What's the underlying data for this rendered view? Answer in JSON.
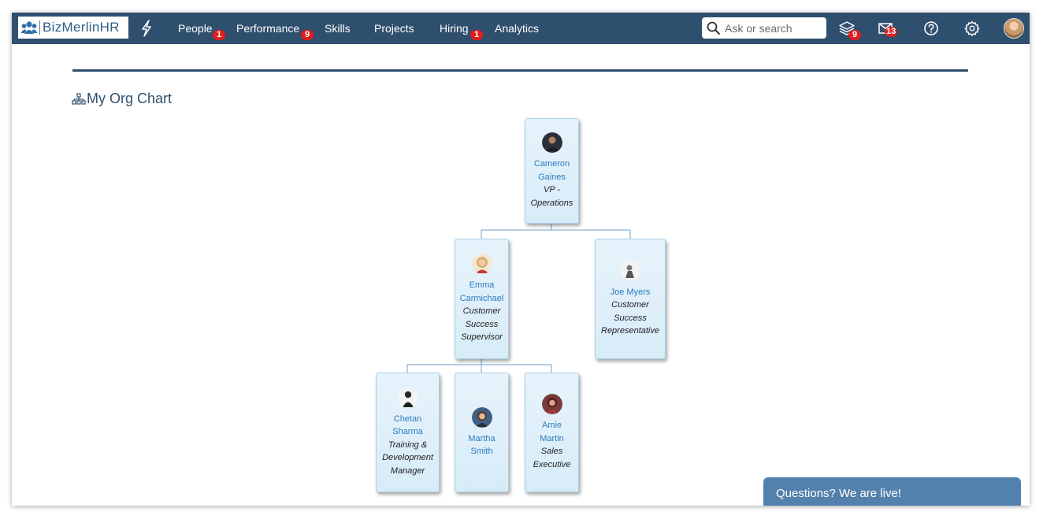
{
  "app": {
    "brand": "BizMerlinHR"
  },
  "nav": {
    "items": [
      {
        "label": "People",
        "badge": "1"
      },
      {
        "label": "Performance",
        "badge": "9"
      },
      {
        "label": "Skills",
        "badge": ""
      },
      {
        "label": "Projects",
        "badge": ""
      },
      {
        "label": "Hiring",
        "badge": "1"
      },
      {
        "label": "Analytics",
        "badge": ""
      }
    ],
    "search_placeholder": "Ask or search",
    "icons": [
      {
        "name": "layers-icon",
        "badge": "9"
      },
      {
        "name": "mail-icon",
        "badge": "13"
      },
      {
        "name": "help-icon",
        "badge": ""
      },
      {
        "name": "settings-icon",
        "badge": ""
      }
    ]
  },
  "page": {
    "title": "My Org Chart"
  },
  "org_chart": {
    "root": {
      "name_line1": "Cameron",
      "name_line2": "Gaines",
      "role_line1": "VP -",
      "role_line2": "Operations"
    },
    "level2": [
      {
        "name_line1": "Emma",
        "name_line2": "Carmichael",
        "role_line1": "Customer",
        "role_line2": "Success",
        "role_line3": "Supervisor"
      },
      {
        "name_line1": "Joe Myers",
        "role_line1": "Customer",
        "role_line2": "Success",
        "role_line3": "Representative"
      }
    ],
    "level3": [
      {
        "name_line1": "Chetan",
        "name_line2": "Sharma",
        "role_line1": "Training &",
        "role_line2": "Development",
        "role_line3": "Manager"
      },
      {
        "name_line1": "Martha",
        "name_line2": "Smith"
      },
      {
        "name_line1": "Amie",
        "name_line2": "Martin",
        "role_line1": "Sales",
        "role_line2": "Executive"
      }
    ]
  },
  "chat": {
    "label": "Questions? We are live!"
  },
  "colors": {
    "nav_bg": "#2f4f6f",
    "badge": "#e01e1e",
    "link": "#2c7bc0",
    "chat_bg": "#5381ad"
  }
}
